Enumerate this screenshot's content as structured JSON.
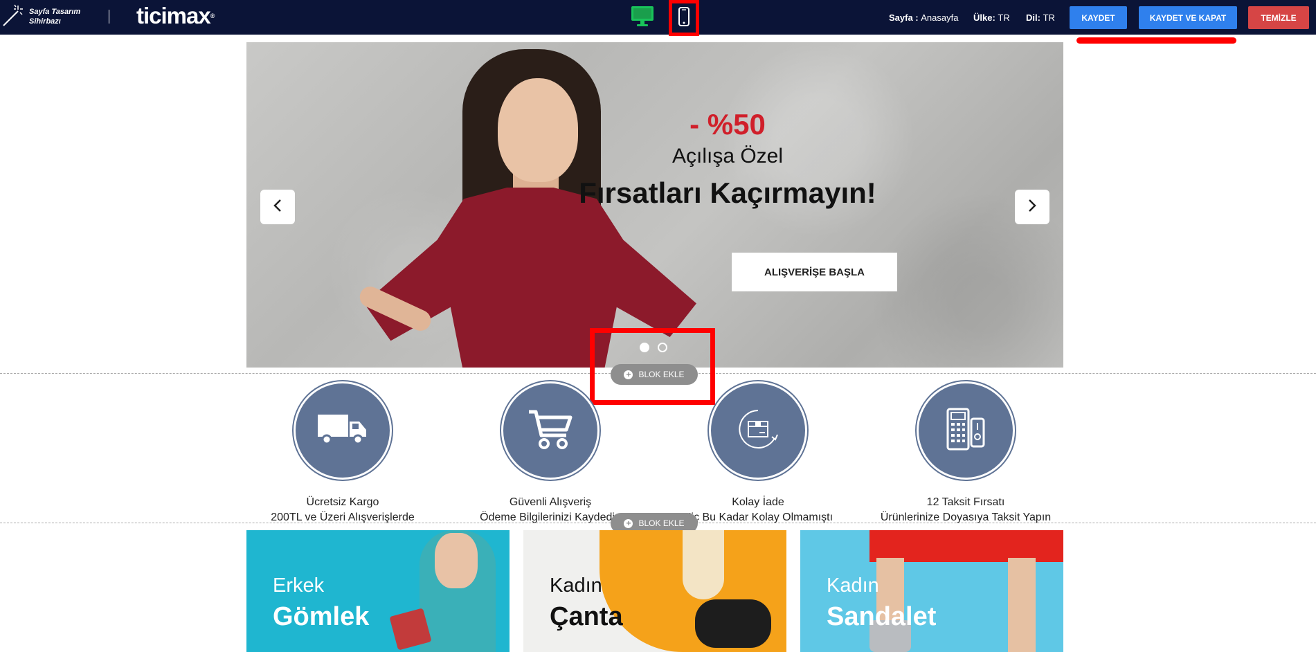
{
  "topbar": {
    "wizard_line1": "Sayfa Tasarım",
    "wizard_line2": "Sihirbazı",
    "logo": "ticimax",
    "logo_mark": "®",
    "page_label": "Sayfa :",
    "page_value": "Anasayfa",
    "country_label": "Ülke:",
    "country_value": "TR",
    "lang_label": "Dil:",
    "lang_value": "TR",
    "save": "KAYDET",
    "save_close": "KAYDET VE KAPAT",
    "clear": "TEMİZLE"
  },
  "slider": {
    "discount": "- %50",
    "subtitle": "Açılışa Özel",
    "headline": "Fırsatları Kaçırmayın!",
    "cta": "ALIŞVERİŞE BAŞLA"
  },
  "block_add": "BLOK EKLE",
  "features": [
    {
      "title": "Ücretsiz Kargo",
      "desc": "200TL ve Üzeri Alışverişlerde",
      "icon": "truck-icon"
    },
    {
      "title": "Güvenli Alışveriş",
      "desc": "Ödeme Bilgilerinizi Kaydedin",
      "icon": "cart-icon"
    },
    {
      "title": "Kolay İade",
      "desc": "Hiç Bu Kadar Kolay Olmamıştı",
      "icon": "return-box-icon"
    },
    {
      "title": "12 Taksit Fırsatı",
      "desc": "Ürünlerinize Doyasıya Taksit Yapın",
      "icon": "pos-terminal-icon"
    }
  ],
  "categories": [
    {
      "line1": "Erkek",
      "line2": "Gömlek"
    },
    {
      "line1": "Kadın",
      "line2": "Çanta"
    },
    {
      "line1": "Kadın",
      "line2": "Sandalet"
    }
  ],
  "colors": {
    "topbar_bg": "#0b1437",
    "primary_button": "#2f80ed",
    "clear_button": "#d64545",
    "highlight": "#ff0000",
    "discount": "#d01f2a",
    "feature_circle": "#5f7395",
    "desktop_icon": "#19c35a"
  }
}
